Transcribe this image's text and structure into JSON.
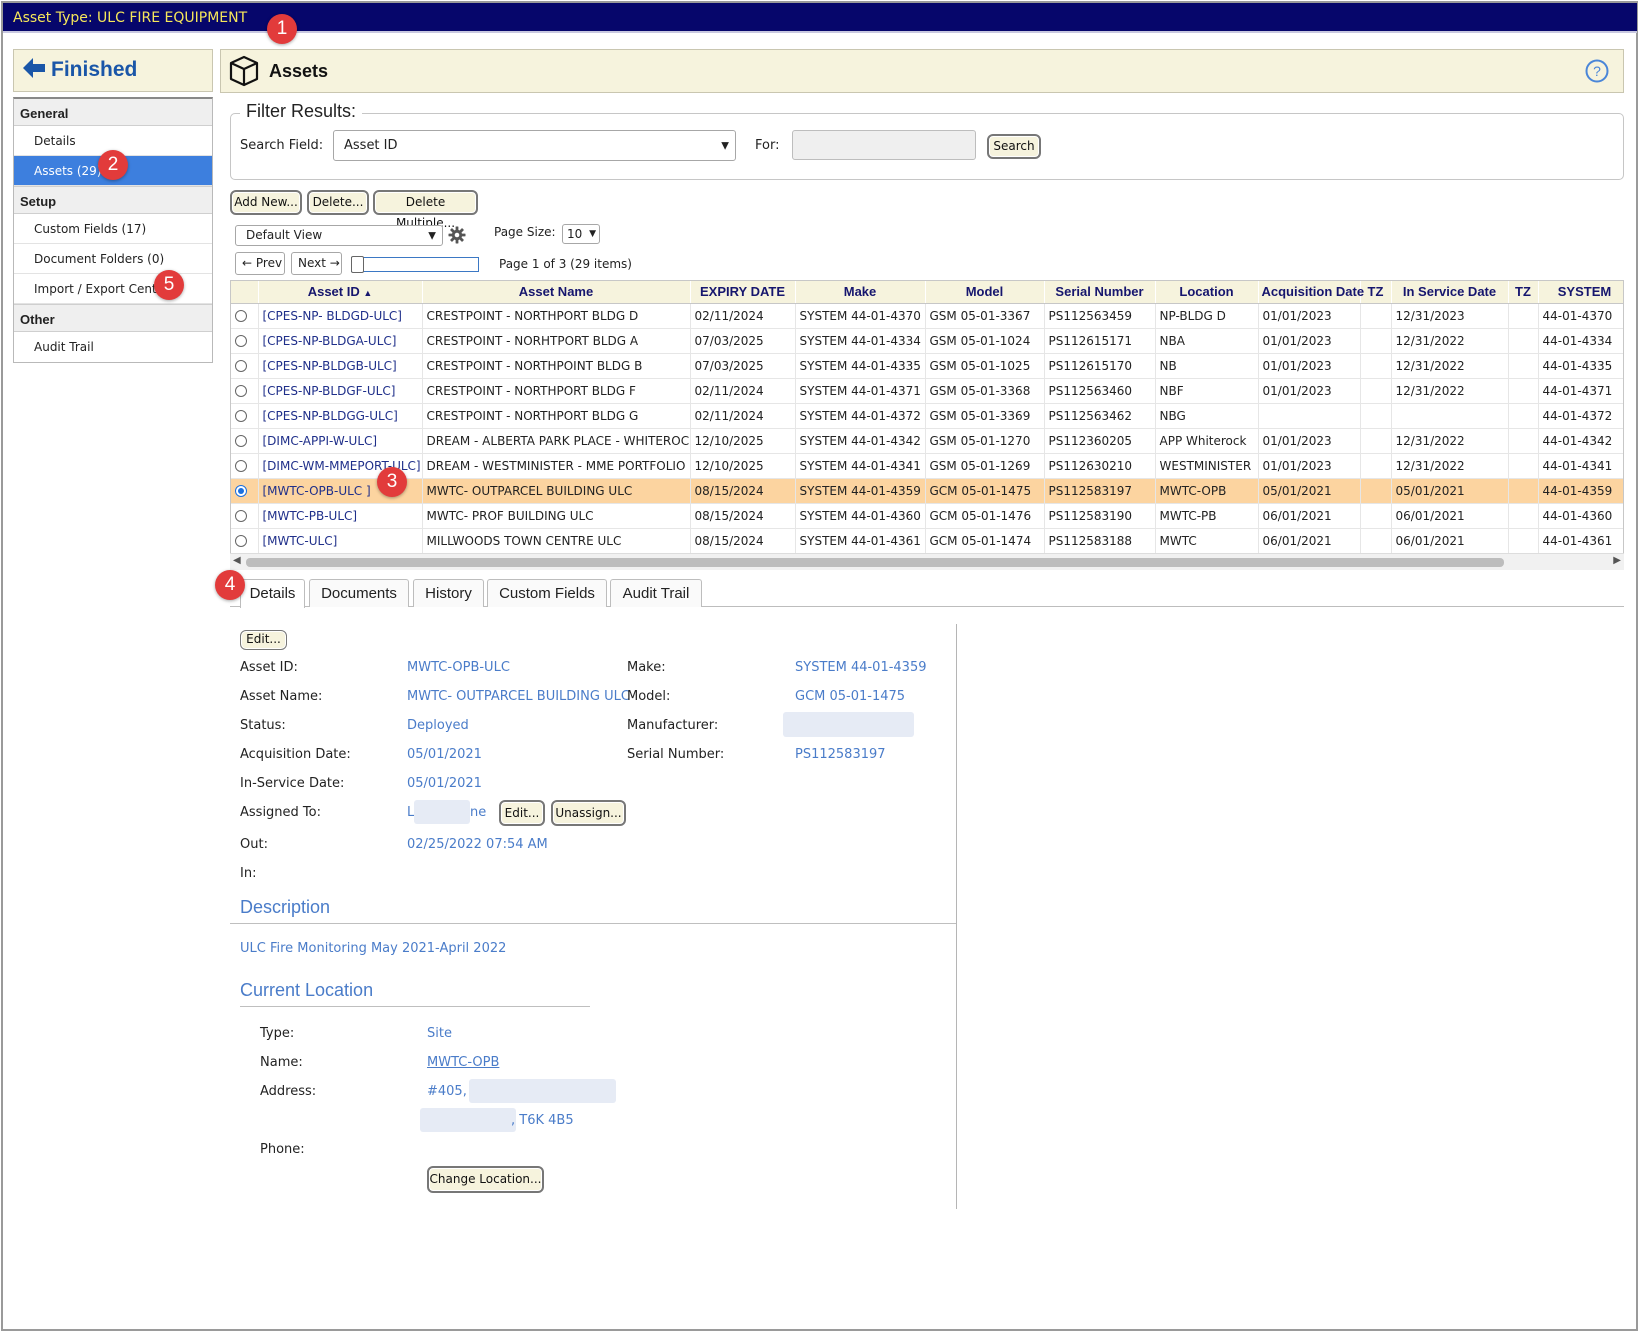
{
  "window": {
    "asset_type_title": "Asset Type: ULC FIRE EQUIPMENT"
  },
  "badges": [
    "1",
    "2",
    "3",
    "4",
    "5"
  ],
  "sidebar": {
    "finished_label": "Finished",
    "sections": [
      {
        "title": "General",
        "items": [
          "Details",
          "Assets (29)"
        ]
      },
      {
        "title": "Setup",
        "items": [
          "Custom Fields (17)",
          "Document Folders (0)",
          "Import / Export Center"
        ]
      },
      {
        "title": "Other",
        "items": [
          "Audit Trail"
        ]
      }
    ]
  },
  "main": {
    "title": "Assets",
    "filter": {
      "legend": "Filter Results:",
      "search_field_label": "Search Field:",
      "search_field_value": "Asset ID",
      "for_label": "For:",
      "search_button": "Search"
    },
    "actions": {
      "add_new": "Add New...",
      "delete": "Delete...",
      "delete_multiple": "Delete Multiple..."
    },
    "view_select": "Default View",
    "page_size_label": "Page Size:",
    "page_size_value": "10",
    "pager": {
      "prev": "Prev",
      "next": "Next",
      "info": "Page 1 of 3 (29 items)"
    }
  },
  "grid": {
    "columns": [
      "Asset ID",
      "Asset Name",
      "EXPIRY DATE",
      "Make",
      "Model",
      "Serial Number",
      "Location",
      "Acquisition Date",
      "TZ",
      "In Service Date",
      "TZ",
      "SYSTEM"
    ],
    "sort_column": "Asset ID",
    "selected_row": 7,
    "rows": [
      [
        "[CPES-NP- BLDGD-ULC]",
        "CRESTPOINT - NORTHPORT BLDG D",
        "02/11/2024",
        "SYSTEM 44-01-4370",
        "GSM 05-01-3367",
        "PS112563459",
        "NP-BLDG D",
        "01/01/2023",
        "",
        "12/31/2023",
        "",
        "44-01-4370"
      ],
      [
        "[CPES-NP-BLDGA-ULC]",
        "CRESTPOINT - NORHTPORT BLDG A",
        "07/03/2025",
        "SYSTEM 44-01-4334",
        "GSM 05-01-1024",
        "PS112615171",
        "NBA",
        "01/01/2023",
        "",
        "12/31/2022",
        "",
        "44-01-4334"
      ],
      [
        "[CPES-NP-BLDGB-ULC]",
        "CRESTPOINT - NORTHPOINT BLDG B",
        "07/03/2025",
        "SYSTEM 44-01-4335",
        "GSM 05-01-1025",
        "PS112615170",
        "NB",
        "01/01/2023",
        "",
        "12/31/2022",
        "",
        "44-01-4335"
      ],
      [
        "[CPES-NP-BLDGF-ULC]",
        "CRESTPOINT - NORTHPORT BLDG F",
        "02/11/2024",
        "SYSTEM 44-01-4371",
        "GSM 05-01-3368",
        "PS112563460",
        "NBF",
        "01/01/2023",
        "",
        "12/31/2022",
        "",
        "44-01-4371"
      ],
      [
        "[CPES-NP-BLDGG-ULC]",
        "CRESTPOINT - NORTHPORT BLDG G",
        "02/11/2024",
        "SYSTEM 44-01-4372",
        "GSM 05-01-3369",
        "PS112563462",
        "NBG",
        "",
        "",
        "",
        "",
        "44-01-4372"
      ],
      [
        "[DIMC-APPI-W-ULC]",
        "DREAM - ALBERTA PARK PLACE - WHITEROCK",
        "12/10/2025",
        "SYSTEM 44-01-4342",
        "GSM 05-01-1270",
        "PS112360205",
        "APP Whiterock",
        "01/01/2023",
        "",
        "12/31/2022",
        "",
        "44-01-4342"
      ],
      [
        "[DIMC-WM-MMEPORT-ULC]",
        "DREAM - WESTMINISTER - MME PORTFOLIO",
        "12/10/2025",
        "SYSTEM 44-01-4341",
        "GSM 05-01-1269",
        "PS112630210",
        "WESTMINISTER",
        "01/01/2023",
        "",
        "12/31/2022",
        "",
        "44-01-4341"
      ],
      [
        "[MWTC-OPB-ULC ]",
        "MWTC- OUTPARCEL BUILDING ULC",
        "08/15/2024",
        "SYSTEM 44-01-4359",
        "GCM 05-01-1475",
        "PS112583197",
        "MWTC-OPB",
        "05/01/2021",
        "",
        "05/01/2021",
        "",
        "44-01-4359"
      ],
      [
        "[MWTC-PB-ULC]",
        "MWTC- PROF BUILDING ULC",
        "08/15/2024",
        "SYSTEM 44-01-4360",
        "GCM 05-01-1476",
        "PS112583190",
        "MWTC-PB",
        "06/01/2021",
        "",
        "06/01/2021",
        "",
        "44-01-4360"
      ],
      [
        "[MWTC-ULC]",
        "MILLWOODS TOWN CENTRE ULC",
        "08/15/2024",
        "SYSTEM 44-01-4361",
        "GCM 05-01-1474",
        "PS112583188",
        "MWTC",
        "06/01/2021",
        "",
        "06/01/2021",
        "",
        "44-01-4361"
      ]
    ]
  },
  "tabs": [
    "Details",
    "Documents",
    "History",
    "Custom Fields",
    "Audit Trail"
  ],
  "details": {
    "edit_button": "Edit...",
    "asset_id_label": "Asset ID:",
    "asset_id": "MWTC-OPB-ULC",
    "asset_name_label": "Asset Name:",
    "asset_name": "MWTC- OUTPARCEL BUILDING ULC",
    "status_label": "Status:",
    "status": "Deployed",
    "acq_label": "Acquisition Date:",
    "acq_date": "05/01/2021",
    "inservice_label": "In-Service Date:",
    "inservice_date": "05/01/2021",
    "assigned_label": "Assigned To:",
    "assigned_prefix": "L",
    "assigned_suffix": "ne",
    "assigned_edit": "Edit...",
    "unassign": "Unassign...",
    "out_label": "Out:",
    "out_value": "02/25/2022 07:54 AM",
    "in_label": "In:",
    "make_label": "Make:",
    "make": "SYSTEM 44-01-4359",
    "model_label": "Model:",
    "model": "GCM 05-01-1475",
    "manufacturer_label": "Manufacturer:",
    "serial_label": "Serial Number:",
    "serial": "PS112583197",
    "description_heading": "Description",
    "description": "ULC Fire Monitoring May 2021-April 2022",
    "location_heading": "Current Location",
    "type_label": "Type:",
    "type": "Site",
    "name_label": "Name:",
    "name": "MWTC-OPB",
    "address_label": "Address:",
    "address_line1": "#405,",
    "address_line2": ", T6K 4B5",
    "phone_label": "Phone:",
    "change_location": "Change Location..."
  }
}
